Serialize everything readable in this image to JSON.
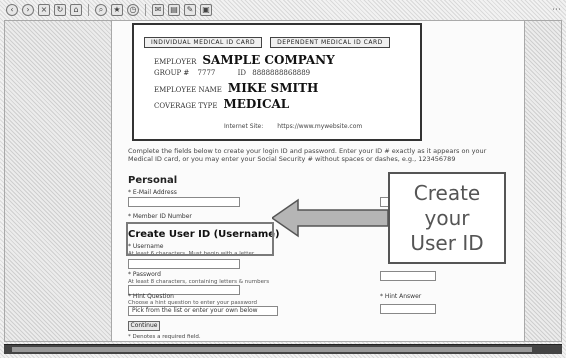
{
  "toolbar": {
    "icons": [
      "back-icon",
      "forward-icon",
      "stop-icon",
      "refresh-icon",
      "home-icon",
      "search-icon",
      "favorites-icon",
      "history-icon",
      "mail-icon",
      "print-icon",
      "edit-icon"
    ]
  },
  "card": {
    "tab_left": "INDIVIDUAL MEDICAL ID CARD",
    "tab_right": "DEPENDENT MEDICAL ID CARD",
    "group_label": "EMPLOYER",
    "group_value": "SAMPLE COMPANY",
    "group_number_label": "GROUP #",
    "group_number": "7777",
    "id_label": "ID",
    "id_value": "8888888868889",
    "employee_label": "EMPLOYEE NAME",
    "employee_value": "MIKE SMITH",
    "coverage_label": "COVERAGE TYPE",
    "coverage_value": "MEDICAL",
    "footer_left": "Internet Site:",
    "footer_right": "https://www.mywebsite.com"
  },
  "instructions": "Complete the fields below to create your login ID and password. Enter your ID # exactly as it appears on your Medical ID card, or you may enter your Social Security # without spaces or dashes, e.g., 123456789",
  "personal": {
    "heading": "Personal",
    "email_label": "* E-Mail Address",
    "member_label": "* Member ID Number"
  },
  "create": {
    "heading": "Create User ID (Username)",
    "username_label": "* Username",
    "username_hint": "At least 6 characters. Must begin with a letter.",
    "password_label": "* Password",
    "password_hint": "At least 8 characters, containing letters & numbers",
    "question_label": "* Hint Question",
    "question_hint": "Choose a hint question to enter your password",
    "question_select": "Pick from the list or enter your own below",
    "own_label": "Or enter your own here",
    "answer_label": "* Hint Answer"
  },
  "continue_label": "Continue",
  "footnote": "* Denotes a required field.",
  "callout": {
    "text": "Create\nyour\nUser ID"
  }
}
